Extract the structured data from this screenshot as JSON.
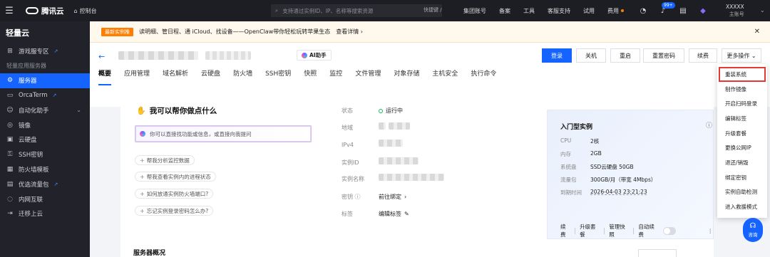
{
  "topbar": {
    "brand": "腾讯云",
    "console": "控制台",
    "search_placeholder": "支持通过实例ID、IP、名称等搜索资源",
    "shortcut": "快捷键 /",
    "nav": [
      "集团账号",
      "备案",
      "工具",
      "客服支持",
      "试用",
      "费用"
    ],
    "badge": "99+",
    "user_name": "XXXXX",
    "user_role": "主账号"
  },
  "sidebar": {
    "title": "轻量云",
    "items": [
      {
        "label": "游戏服专区",
        "icon": "gamepad-icon",
        "external": true
      },
      {
        "label": "服务器",
        "icon": "server-icon",
        "active": true
      },
      {
        "label": "OrcaTerm",
        "icon": "terminal-icon",
        "external": true
      },
      {
        "label": "自动化助手",
        "icon": "robot-icon",
        "has_submenu": true
      },
      {
        "label": "镜像",
        "icon": "disc-icon"
      },
      {
        "label": "云硬盘",
        "icon": "disk-icon"
      },
      {
        "label": "SSH密钥",
        "icon": "key-icon"
      },
      {
        "label": "防火墙模板",
        "icon": "firewall-icon"
      },
      {
        "label": "优选流量包",
        "icon": "package-icon",
        "external": true
      },
      {
        "label": "内网互联",
        "icon": "network-icon"
      },
      {
        "label": "迁移上云",
        "icon": "migrate-icon"
      }
    ],
    "section_label": "轻量应用服务器"
  },
  "notice": {
    "tag": "最新实例推",
    "text": "读明细、管日程、通 iCloud、找设备——OpenClaw带你轻松玩转苹果生态",
    "more": "查看详情 ›"
  },
  "header": {
    "ai_label": "AI助手",
    "buttons": [
      "登录",
      "关机",
      "重启",
      "重置密码",
      "续费",
      "更多操作 ⌄"
    ],
    "tabs": [
      "概要",
      "应用管理",
      "域名解析",
      "云硬盘",
      "防火墙",
      "SSH密钥",
      "快照",
      "监控",
      "文件管理",
      "对象存储",
      "主机安全",
      "执行命令"
    ]
  },
  "assistant": {
    "title": "我可以帮你做点什么",
    "input_placeholder": "你可以直接找功能或信息，或直接向我提问",
    "suggestions": [
      "帮我分析监控数据",
      "帮我查看实例内的进程状态",
      "如何放通实例防火墙端口?",
      "忘记实例登录密码怎么办?"
    ]
  },
  "info": {
    "labels": [
      "状态",
      "地域",
      "IPv4",
      "实例ID",
      "实例名称",
      "密钥",
      "标签"
    ],
    "status_value": "运行中",
    "key_value": "前往绑定",
    "tag_value": "编辑标签"
  },
  "spec": {
    "title": "入门型实例",
    "rows": [
      {
        "k": "CPU",
        "v": "2核"
      },
      {
        "k": "内存",
        "v": "2GB"
      },
      {
        "k": "系统盘",
        "v": "SSD云硬盘 50GB"
      },
      {
        "k": "流量包",
        "v": "300GB/月（带宽 4Mbps）"
      },
      {
        "k": "到期时间",
        "v": "2026-04-03 23:21:23"
      }
    ],
    "actions": [
      "续费",
      "升级套餐",
      "管理快照",
      "自动续费"
    ]
  },
  "dropdown": {
    "items": [
      "重装系统",
      "制作镜像",
      "开启扫码登录",
      "编辑标签",
      "升级套餐",
      "更换公网IP",
      "退还/销毁",
      "绑定密钥",
      "实例自助检测",
      "进入救援模式"
    ],
    "highlighted_index": 0
  },
  "help": {
    "label": "咨询"
  },
  "lower": {
    "title": "服务器概况"
  },
  "colors": {
    "primary": "#1664ff",
    "sidebar": "#22232a",
    "topbar": "#1d1e23",
    "notice_tag": "#ff7d00",
    "status": "#0abf5b",
    "highlight": "#e53935"
  }
}
